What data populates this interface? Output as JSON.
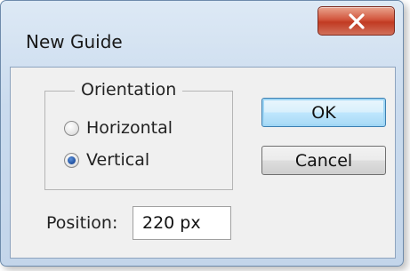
{
  "window": {
    "title": "New Guide",
    "close_glyph": "X"
  },
  "orientation": {
    "legend": "Orientation",
    "options": [
      {
        "label": "Horizontal",
        "checked": false
      },
      {
        "label": "Vertical",
        "checked": true
      }
    ]
  },
  "buttons": {
    "ok": "OK",
    "cancel": "Cancel"
  },
  "position": {
    "label": "Position:",
    "value": "220 px"
  },
  "colors": {
    "close_button": "#c8452e",
    "default_button_border": "#3c7fb1",
    "radio_selected": "#1f4f9e"
  }
}
